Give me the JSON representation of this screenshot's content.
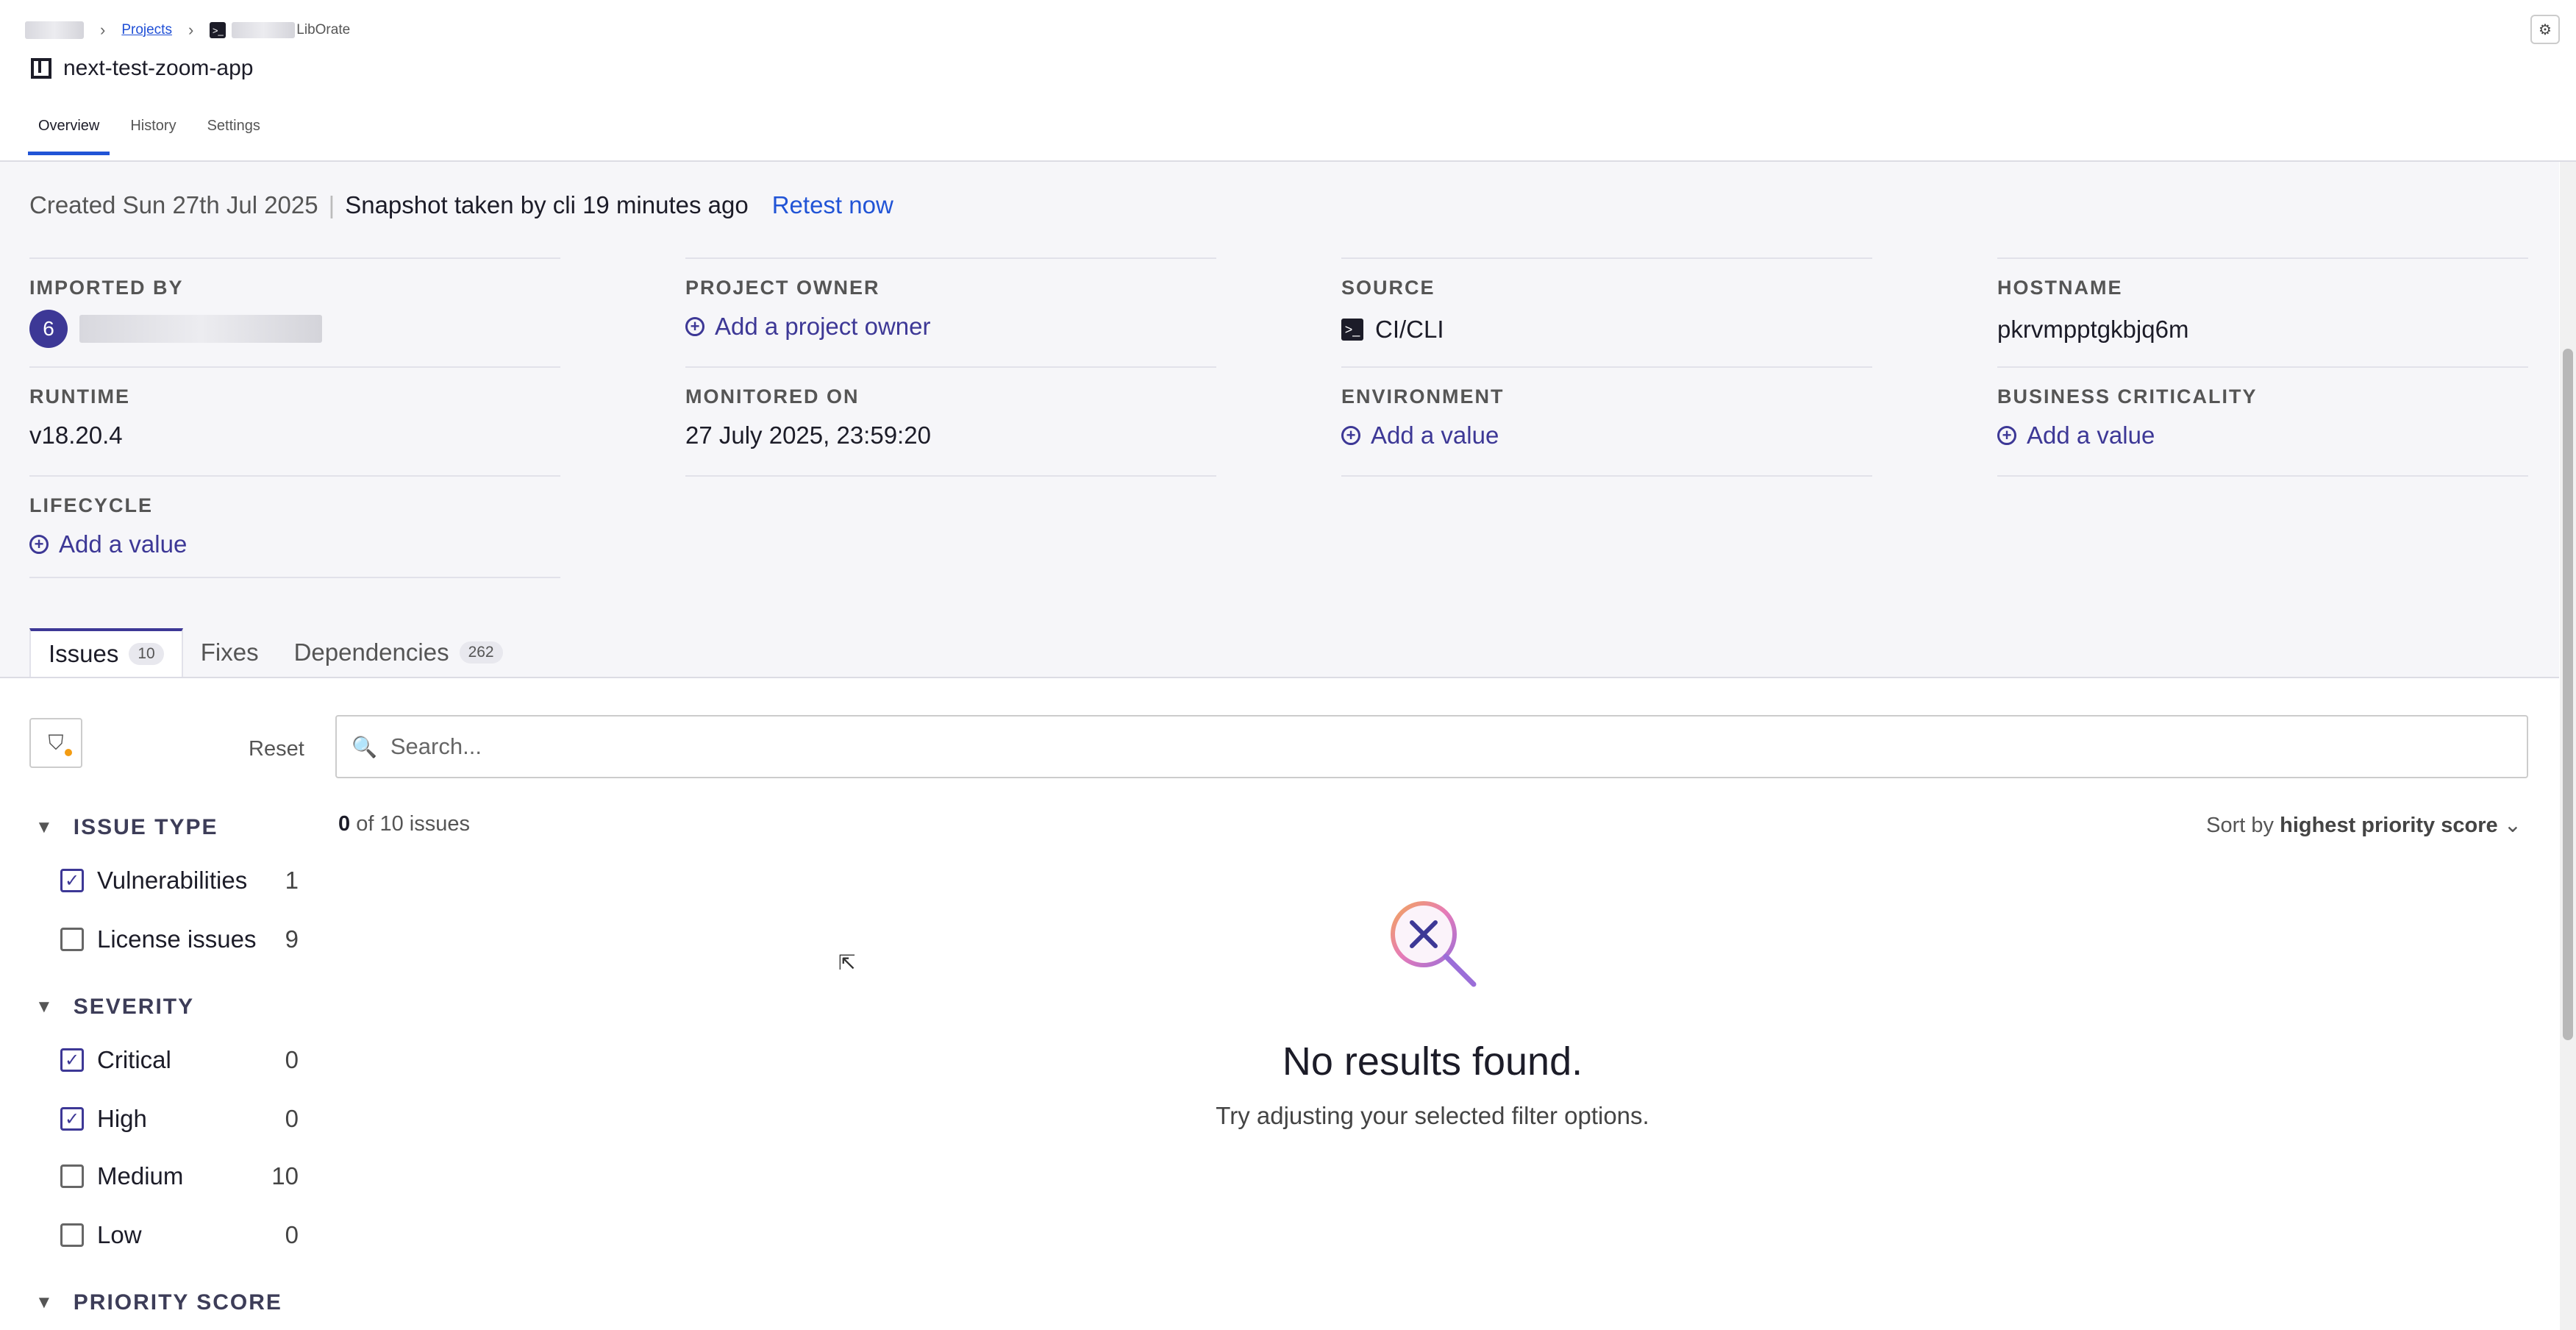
{
  "breadcrumb": {
    "projects": "Projects",
    "project": "LibOrate",
    "sep": "›"
  },
  "project": {
    "title": "next-test-zoom-app"
  },
  "top_tabs": [
    {
      "label": "Overview"
    },
    {
      "label": "History"
    },
    {
      "label": "Settings"
    }
  ],
  "meta": {
    "created": "Created Sun 27th Jul 2025",
    "divider": "|",
    "snapshot": "Snapshot taken by cli 19 minutes ago",
    "retest": "Retest now"
  },
  "fields": {
    "imported_by": {
      "label": "IMPORTED BY",
      "avatar": "6"
    },
    "project_owner": {
      "label": "PROJECT OWNER",
      "action": "Add a project owner"
    },
    "source": {
      "label": "SOURCE",
      "value": "CI/CLI"
    },
    "hostname": {
      "label": "HOSTNAME",
      "value": "pkrvmpptgkbjq6m"
    },
    "runtime": {
      "label": "RUNTIME",
      "value": "v18.20.4"
    },
    "monitored_on": {
      "label": "MONITORED ON",
      "value": "27 July 2025, 23:59:20"
    },
    "environment": {
      "label": "ENVIRONMENT",
      "action": "Add a value"
    },
    "business_criticality": {
      "label": "BUSINESS CRITICALITY",
      "action": "Add a value"
    },
    "lifecycle": {
      "label": "LIFECYCLE",
      "action": "Add a value"
    }
  },
  "issue_tabs": {
    "issues": {
      "label": "Issues",
      "count": "10"
    },
    "fixes": {
      "label": "Fixes"
    },
    "dependencies": {
      "label": "Dependencies",
      "count": "262"
    }
  },
  "filters": {
    "reset": "Reset",
    "issue_type": {
      "title": "ISSUE TYPE",
      "options": [
        {
          "label": "Vulnerabilities",
          "count": "1",
          "checked": true
        },
        {
          "label": "License issues",
          "count": "9",
          "checked": false
        }
      ]
    },
    "severity": {
      "title": "SEVERITY",
      "options": [
        {
          "label": "Critical",
          "count": "0",
          "checked": true
        },
        {
          "label": "High",
          "count": "0",
          "checked": true
        },
        {
          "label": "Medium",
          "count": "10",
          "checked": false
        },
        {
          "label": "Low",
          "count": "0",
          "checked": false
        }
      ]
    },
    "priority_score": {
      "title": "PRIORITY SCORE"
    }
  },
  "search": {
    "placeholder": "Search..."
  },
  "results": {
    "shown": "0",
    "of_text": "of 10 issues",
    "sort_prefix": "Sort by",
    "sort_value": "highest priority score"
  },
  "empty": {
    "title": "No results found.",
    "subtitle": "Try adjusting your selected filter options."
  },
  "colors": {
    "accent": "#2154d6",
    "brand": "#3d3896",
    "indicator": "#f39c12"
  }
}
